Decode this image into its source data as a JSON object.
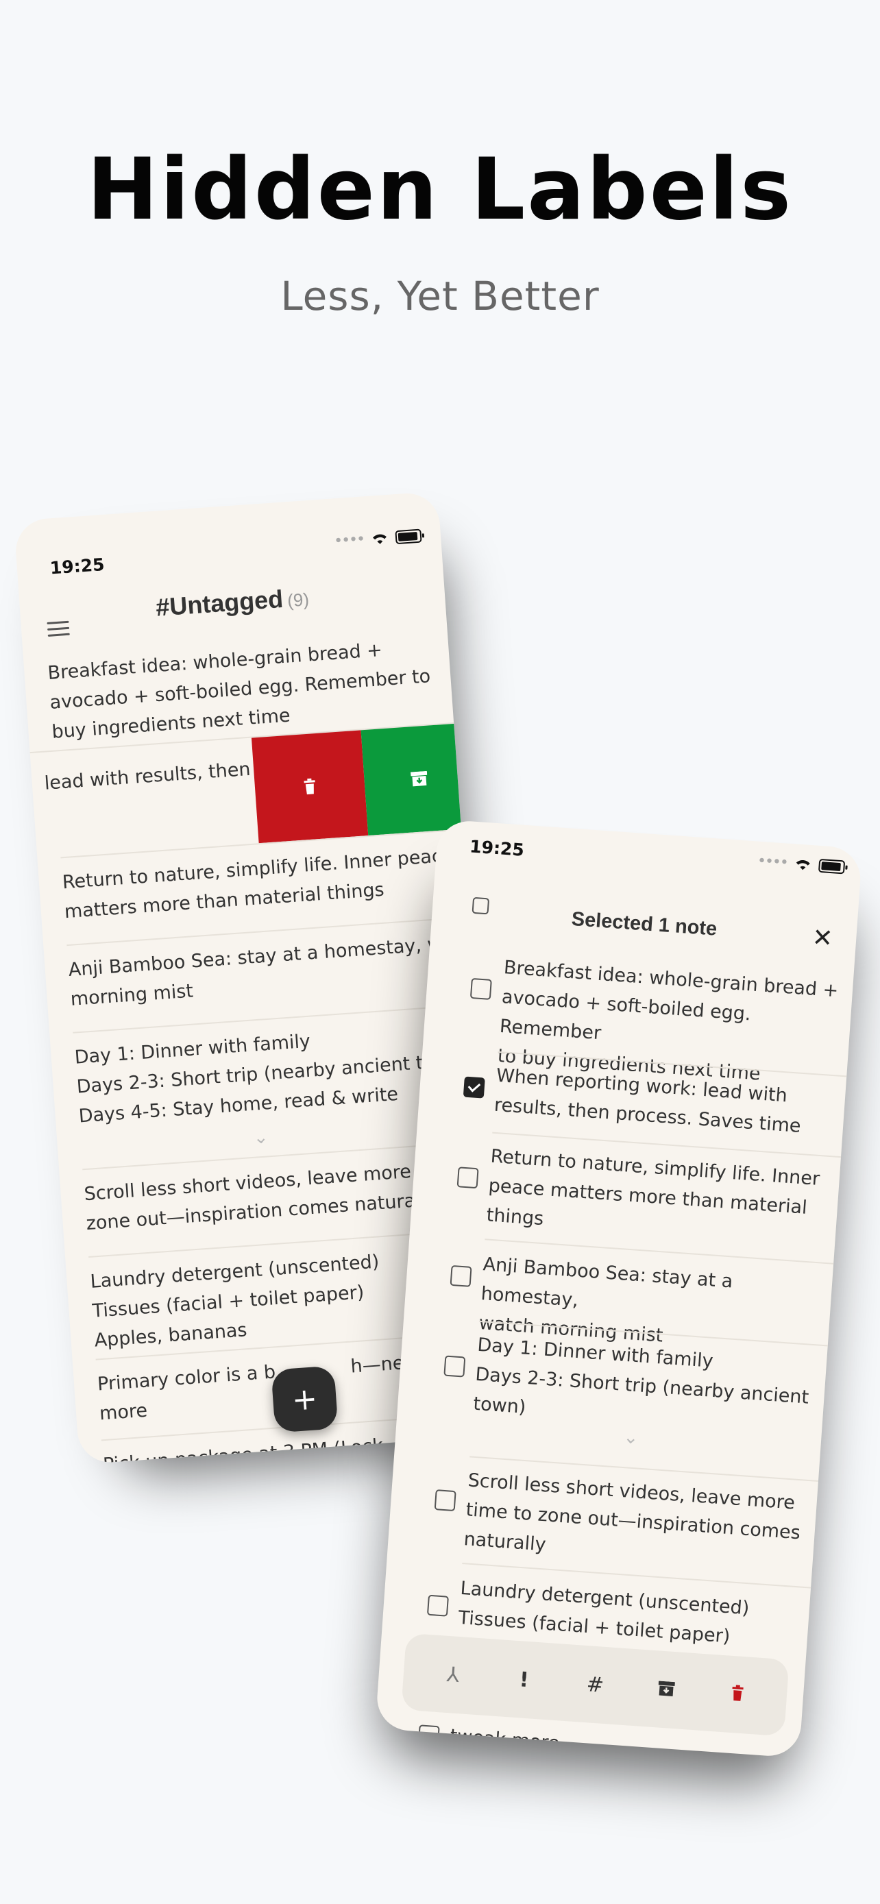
{
  "hero": {
    "title": "Hidden Labels",
    "subtitle": "Less, Yet Better"
  },
  "left_phone": {
    "status_time": "19:25",
    "title": "#Untagged",
    "count": "(9)",
    "notes": [
      {
        "line1": "Breakfast idea: whole-grain bread +",
        "line2": "avocado + soft-boiled egg. Remember to",
        "line3": "buy ingredients next time"
      },
      {
        "line1": "lead with results, then"
      },
      {
        "line1": "Return to nature, simplify life. Inner peace",
        "line2": "matters more than material things"
      },
      {
        "line1": "Anji Bamboo Sea: stay at a homestay, wat",
        "line2": "morning mist"
      },
      {
        "line1": "Day 1: Dinner with family",
        "line2": "Days 2-3: Short trip (nearby ancient to",
        "line3": "Days 4-5: Stay home, read & write"
      },
      {
        "line1": "Scroll less short videos, leave more t",
        "line2": "zone out—inspiration comes natural"
      },
      {
        "line1": "Laundry detergent (unscented)",
        "line2": "Tissues (facial + toilet paper)",
        "line3": "Apples, bananas"
      },
      {
        "line1": "Primary color is a b",
        "line1b": "h—nee",
        "line2": "more"
      },
      {
        "line1": "Pick up package at 3 PM (Lock"
      }
    ],
    "fab_label": "+",
    "swipe": {
      "delete_color": "#c4161c",
      "archive_color": "#0b9a3c"
    }
  },
  "right_phone": {
    "status_time": "19:25",
    "title": "Selected 1 note",
    "close_label": "✕",
    "notes": [
      {
        "checked": false,
        "line1": "Breakfast idea: whole-grain bread +",
        "line2": "avocado + soft-boiled egg. Remember",
        "line3": "to buy ingredients next time"
      },
      {
        "checked": true,
        "line1": "When reporting work: lead with",
        "line2": "results, then process. Saves time"
      },
      {
        "checked": false,
        "line1": "Return to nature, simplify life. Inner",
        "line2": "peace matters more than material",
        "line3": "things"
      },
      {
        "checked": false,
        "line1": "Anji Bamboo Sea: stay at a homestay,",
        "line2": "watch morning mist"
      },
      {
        "checked": false,
        "line1": "Day 1: Dinner with family",
        "line2": "Days 2-3: Short trip (nearby ancient",
        "line3": "town)"
      },
      {
        "checked": false,
        "line1": "Scroll less short videos, leave more",
        "line2": "time to zone out—inspiration comes",
        "line3": "naturally"
      },
      {
        "checked": false,
        "line1": "Laundry detergent (unscented)",
        "line2": "Tissues (facial + toilet paper)"
      },
      {
        "checked": false,
        "line1": "tweak more"
      }
    ],
    "toolbar": [
      {
        "name": "merge-icon",
        "glyph": "⅄"
      },
      {
        "name": "priority-icon",
        "glyph": "!"
      },
      {
        "name": "tag-icon",
        "glyph": "#"
      },
      {
        "name": "archive-icon",
        "glyph": ""
      },
      {
        "name": "trash-icon",
        "glyph": ""
      }
    ],
    "trash_color": "#c4161c"
  }
}
